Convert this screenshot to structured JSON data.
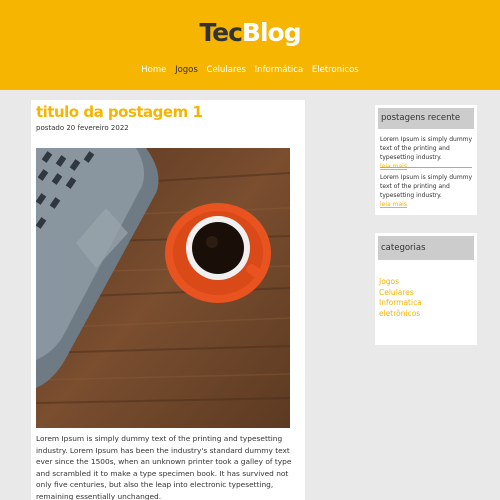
{
  "logo": {
    "part1": "Tec",
    "part2": "Blog"
  },
  "nav": [
    "Home",
    "Jogos",
    "Celulares",
    "Informática",
    "Eletronicos"
  ],
  "post": {
    "title": "titulo da postagem 1",
    "date": "postado 20 fevereiro 2022",
    "text": "Lorem Ipsum is simply dummy text of the printing and typesetting industry. Lorem Ipsum has been the industry's standard dummy text ever since the 1500s, when an unknown printer took a galley of type and scrambled it to make a type specimen book. It has survived not only five centuries, but also the leap into electronic typesetting, remaining essentially unchanged."
  },
  "recent": {
    "title": "postagens recente",
    "items": [
      {
        "text": "Lorem Ipsum is simply dummy text of the printing and typesetting industry.",
        "more": "leia mais"
      },
      {
        "text": "Lorem Ipsum is simply dummy text of the printing and typesetting industry.",
        "more": "leia mais"
      }
    ]
  },
  "categories": {
    "title": "categorias",
    "items": [
      "Jogos",
      "Celulares",
      "Informatica",
      "eletrônicos"
    ]
  }
}
